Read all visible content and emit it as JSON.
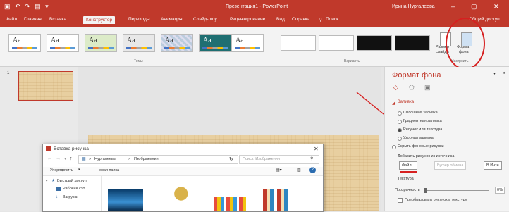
{
  "titlebar": {
    "title": "Презентация1 - PowerPoint",
    "user": "Ирина Нургалеева",
    "minimize": "–",
    "restore": "▢",
    "close": "✕"
  },
  "tabs": [
    "Файл",
    "Главная",
    "Вставка",
    "Конструктор",
    "Переходы",
    "Анимация",
    "Слайд-шоу",
    "Рецензирование",
    "Вид",
    "Справка",
    "Поиск"
  ],
  "share": "Общий доступ",
  "ribbon": {
    "themes_label": "Темы",
    "variants_label": "Варианты",
    "customize_label": "Настроить",
    "theme_texts": [
      "Aa",
      "Aa",
      "Aa",
      "Aa",
      "Aa",
      "Aa",
      "Aa"
    ],
    "slide_size": "Размер\nслайда",
    "format_background": "Формат\nфона"
  },
  "pane": {
    "title": "Формат фона",
    "section": "Заливка",
    "options": [
      "Сплошная заливка",
      "Градиентная заливка",
      "Рисунок или текстура",
      "Узорная заливка",
      "Скрыть фоновые рисунки"
    ],
    "insert_label": "Добавить рисунок из источника",
    "file_button": "Файл...",
    "clipboard_button": "Буфер обмена",
    "online_button": "В Инте",
    "texture_label": "Текстура",
    "transparency_label": "Прозрачность",
    "tile_label": "Преобразовать рисунок в текстуру",
    "transparency_value": "0%"
  },
  "dialog": {
    "title": "Вставка рисунка",
    "path_items": [
      "Нургалеевы",
      "Изображения"
    ],
    "search_placeholder": "Поиск: Изображения",
    "organize": "Упорядочить",
    "new_folder": "Новая папка",
    "tree": [
      "Быстрый доступ",
      "Рабочий сто",
      "Загрузки"
    ]
  },
  "slide_thumb_number": "1",
  "colors": {
    "accent": "#c0392b",
    "annotation": "#d62020"
  }
}
